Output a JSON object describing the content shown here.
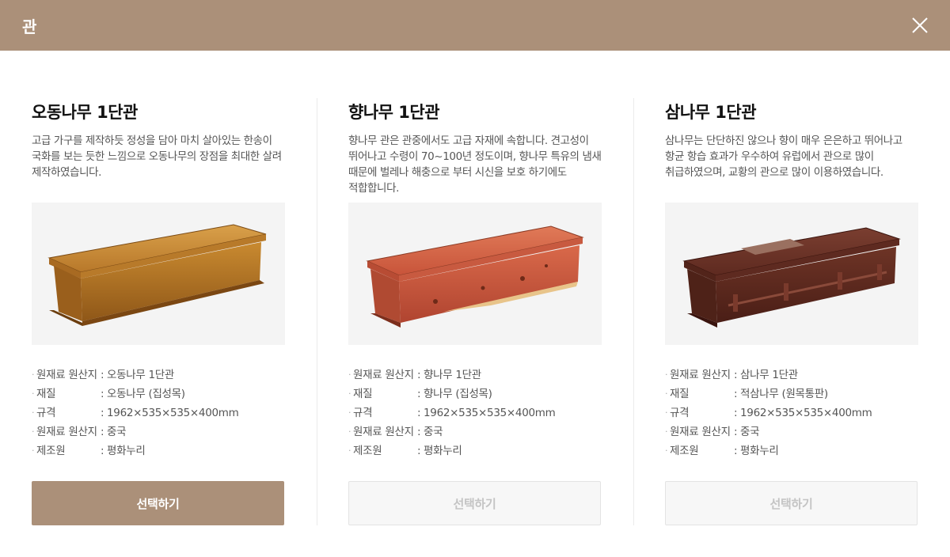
{
  "header": {
    "title": "관"
  },
  "colors": {
    "accent": "#ab9079",
    "icons": [
      "close-icon"
    ]
  },
  "products": [
    {
      "title": "오동나무 1단관",
      "description": "고급 가구를 제작하듯 정성을 담아 마치 살아있는 한송이 국화를 보는 듯한 느낌으로 오동나무의 장점을 최대한 살려 제작하였습니다.",
      "specs": [
        {
          "label": "원재료 원산지",
          "value": "오동나무 1단관"
        },
        {
          "label": "재질",
          "value": "오동나무 (집성목)"
        },
        {
          "label": "규격",
          "value": "1962×535×535×400mm"
        },
        {
          "label": "원재료 원산지",
          "value": "중국"
        },
        {
          "label": "제조원",
          "value": "평화누리"
        }
      ],
      "button_label": "선택하기",
      "selected": true
    },
    {
      "title": "향나무 1단관",
      "description": "향나무 관은 관중에서도 고급 자재에 속합니다. 견고성이 뛰어나고 수령이 70~100년 정도이며, 향나무 특유의 냄새 때문에 벌레나 해충으로 부터 시신을 보호 하기에도 적합합니다.",
      "specs": [
        {
          "label": "원재료 원산지",
          "value": "향나무 1단관"
        },
        {
          "label": "재질",
          "value": "향나무 (집성목)"
        },
        {
          "label": "규격",
          "value": "1962×535×535×400mm"
        },
        {
          "label": "원재료 원산지",
          "value": "중국"
        },
        {
          "label": "제조원",
          "value": "평화누리"
        }
      ],
      "button_label": "선택하기",
      "selected": false
    },
    {
      "title": "삼나무 1단관",
      "description": "삼나무는 단단하진 않으나 향이 매우 은은하고 뛰어나고 항균 항습 효과가 우수하여 유럽에서 관으로 많이 취급하였으며, 교황의 관으로 많이 이용하였습니다.",
      "specs": [
        {
          "label": "원재료 원산지",
          "value": "삼나무 1단관"
        },
        {
          "label": "재질",
          "value": "적삼나무 (원목통판)"
        },
        {
          "label": "규격",
          "value": "1962×535×535×400mm"
        },
        {
          "label": "원재료 원산지",
          "value": "중국"
        },
        {
          "label": "제조원",
          "value": "평화누리"
        }
      ],
      "button_label": "선택하기",
      "selected": false
    }
  ]
}
